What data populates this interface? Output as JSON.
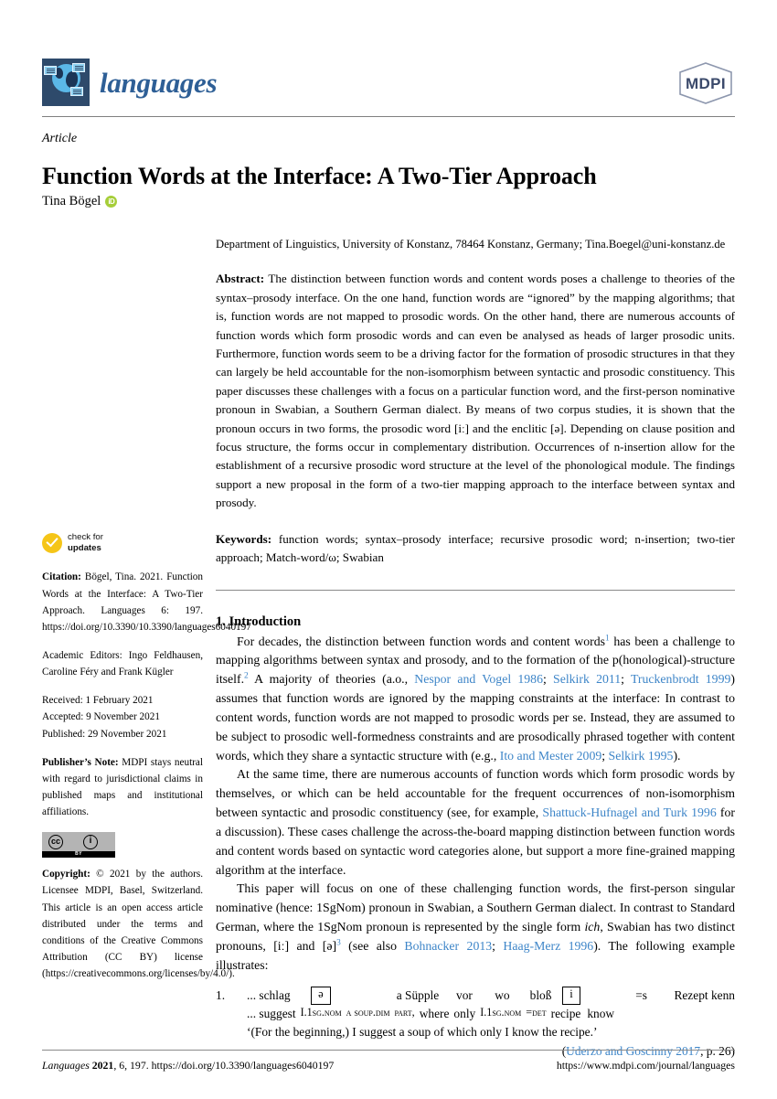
{
  "header": {
    "journal_name": "languages",
    "publisher_logo_text": "MDPI",
    "logo_icon": "globe-speech-bubbles-icon"
  },
  "title_block": {
    "article_type": "Article",
    "title": "Function Words at the Interface: A Two-Tier Approach",
    "author": "Tina Bögel",
    "orcid_label": "iD"
  },
  "affiliation": "Department of Linguistics, University of Konstanz, 78464 Konstanz, Germany; Tina.Boegel@uni-konstanz.de",
  "abstract": {
    "label": "Abstract:",
    "text": " The distinction between function words and content words poses a challenge to theories of the syntax–prosody interface. On the one hand, function words are “ignored” by the mapping algorithms; that is, function words are not mapped to prosodic words. On the other hand, there are numerous accounts of function words which form prosodic words and can even be analysed as heads of larger prosodic units. Furthermore, function words seem to be a driving factor for the formation of prosodic structures in that they can largely be held accountable for the non-isomorphism between syntactic and prosodic constituency. This paper discusses these challenges with a focus on a particular function word, and the first-person nominative pronoun in Swabian, a Southern German dialect. By means of two corpus studies, it is shown that the pronoun occurs in two forms, the prosodic word [iː] and the enclitic [ə]. Depending on clause position and focus structure, the forms occur in complementary distribution. Occurrences of n-insertion allow for the establishment of a recursive prosodic word structure at the level of the phonological module. The findings support a new proposal in the form of a two-tier mapping approach to the interface between syntax and prosody."
  },
  "keywords": {
    "label": "Keywords:",
    "text": " function words; syntax–prosody interface; recursive prosodic word; n-insertion; two-tier approach; Match-word/ω; Swabian"
  },
  "sidebar": {
    "check_updates_line1": "check for",
    "check_updates_line2": "updates",
    "citation_label": "Citation:",
    "citation_text": " Bögel, Tina. 2021. Function Words at the Interface: A Two-Tier Approach. Languages 6: 197. https://doi.org/10.3390/10.3390/languages6040197",
    "citation_journal": "Languages",
    "academic_editors": "Academic Editors: Ingo Feldhausen, Caroline Féry and Frank Kügler",
    "received": "Received: 1 February 2021",
    "accepted": "Accepted: 9 November 2021",
    "published": "Published: 29 November 2021",
    "publisher_note_label": "Publisher’s Note:",
    "publisher_note_text": " MDPI stays neutral with regard to jurisdictional claims in published maps and institutional affiliations.",
    "cc_badge": {
      "cc_mark": "cc",
      "by_mark": "BY",
      "person_mark": "i"
    },
    "copyright_label": "Copyright:",
    "copyright_text": " © 2021 by the authors. Licensee MDPI, Basel, Switzerland. This article is an open access article distributed under the terms and conditions of the Creative Commons Attribution (CC BY) license (https://creativecommons.org/licenses/by/4.0/)."
  },
  "introduction": {
    "heading": "1. Introduction",
    "para1": {
      "seg1": "For decades, the distinction between function words and content words",
      "fn1": "1",
      "seg2": " has been a challenge to mapping algorithms between syntax and prosody, and to the formation of the p(honological)-structure itself.",
      "fn2": "2",
      "seg3": " A majority of theories (a.o., ",
      "cite1": "Nespor and Vogel 1986",
      "sep1": "; ",
      "cite2": "Selkirk 2011",
      "sep2": "; ",
      "cite3": "Truckenbrodt 1999",
      "seg4": ") assumes that function words are ignored by the mapping constraints at the interface: In contrast to content words, function words are not mapped to prosodic words per se. Instead, they are assumed to be subject to prosodic well-formedness constraints and are prosodically phrased together with content words, which they share a syntactic structure with (e.g., ",
      "cite4": "Ito and Mester 2009",
      "sep3": "; ",
      "cite5": "Selkirk 1995",
      "seg5": ")."
    },
    "para2": {
      "seg1": "At the same time, there are numerous accounts of function words which form prosodic words by themselves, or which can be held accountable for the frequent occurrences of non-isomorphism between syntactic and prosodic constituency (see, for example, ",
      "cite1": "Shattuck-Hufnagel and Turk 1996",
      "seg2": " for a discussion). These cases challenge the across-the-board mapping distinction between function words and content words based on syntactic word categories alone, but support a more fine-grained mapping algorithm at the interface."
    },
    "para3": {
      "seg1": "This paper will focus on one of these challenging function words, the first-person singular nominative (hence: 1SgNom) pronoun in Swabian, a Southern German dialect. In contrast to Standard German, where the 1SgNom pronoun is represented by the single form ",
      "italic1": "ich",
      "seg2": ", Swabian has two distinct pronouns, [iː] and [ə]",
      "fn3": "3",
      "seg3": " (see also ",
      "cite1": "Bohnacker 2013",
      "sep1": "; ",
      "cite2": "Haag-Merz 1996",
      "seg4": "). The following example illustrates:"
    }
  },
  "example": {
    "number": "1.",
    "line1": {
      "c1": "... schlag",
      "boxed1": "ə",
      "c2": "a Süpple",
      "c3": "vor",
      "c4": "wo",
      "c5": "bloß",
      "boxed2": "i",
      "c6": "=s",
      "c7": "Rezept kenn"
    },
    "line2": {
      "g1": "... suggest",
      "g2": "I.1sg.nom",
      "g3": "a soup.dim",
      "g4": "part,",
      "g5": "where",
      "g6": "only",
      "g7": "I.1sg.nom",
      "g8": "=det",
      "g9": "recipe",
      "g10": "know"
    },
    "free_translation": "‘(For the beginning,) I suggest a soup of which only I know the recipe.’",
    "source_cite": "Uderzo and Goscinny 2017",
    "source_page": ", p. 26)",
    "source_open": "("
  },
  "footer": {
    "journal_italic": "Languages",
    "year_bold": "2021",
    "issue": ", 6, 197. https://doi.org/10.3390/languages6040197",
    "url": "https://www.mdpi.com/journal/languages"
  },
  "colors": {
    "citation_link": "#3d85c8",
    "journal_blue": "#2e5f96",
    "logo_navy": "#2e4a6b",
    "orcid_green": "#a6ce39",
    "check_yellow": "#f5c518",
    "mdpi_navy": "#3b4a6b"
  }
}
